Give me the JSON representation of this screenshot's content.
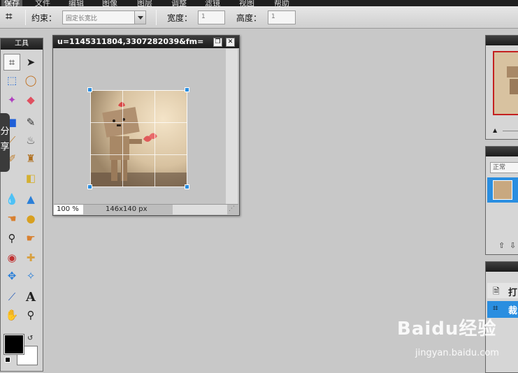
{
  "menu": {
    "items": [
      "保存",
      "文件",
      "编辑",
      "图像",
      "图层",
      "调整",
      "滤镜",
      "视图",
      "帮助"
    ]
  },
  "options": {
    "constraint_label": "约束：",
    "constraint_value": "固定长宽比",
    "width_label": "宽度：",
    "width_value": "1",
    "height_label": "高度：",
    "height_value": "1"
  },
  "tools": {
    "title": "工具"
  },
  "share": {
    "label": "分享"
  },
  "image_window": {
    "title": "u=1145311804,3307282039&fm=",
    "zoom": "100",
    "zoom_unit": "%",
    "dimensions": "146x140 px"
  },
  "history": {
    "items": [
      "打",
      "裁"
    ]
  },
  "layers": {
    "blend": "正常"
  },
  "watermark": {
    "brand": "Baidu经验",
    "url": "jingyan.baidu.com"
  },
  "colors": {
    "accent": "#2a8ee0",
    "titlebar": "#1f1f1f",
    "foreground": "#000000",
    "background": "#ffffff"
  }
}
